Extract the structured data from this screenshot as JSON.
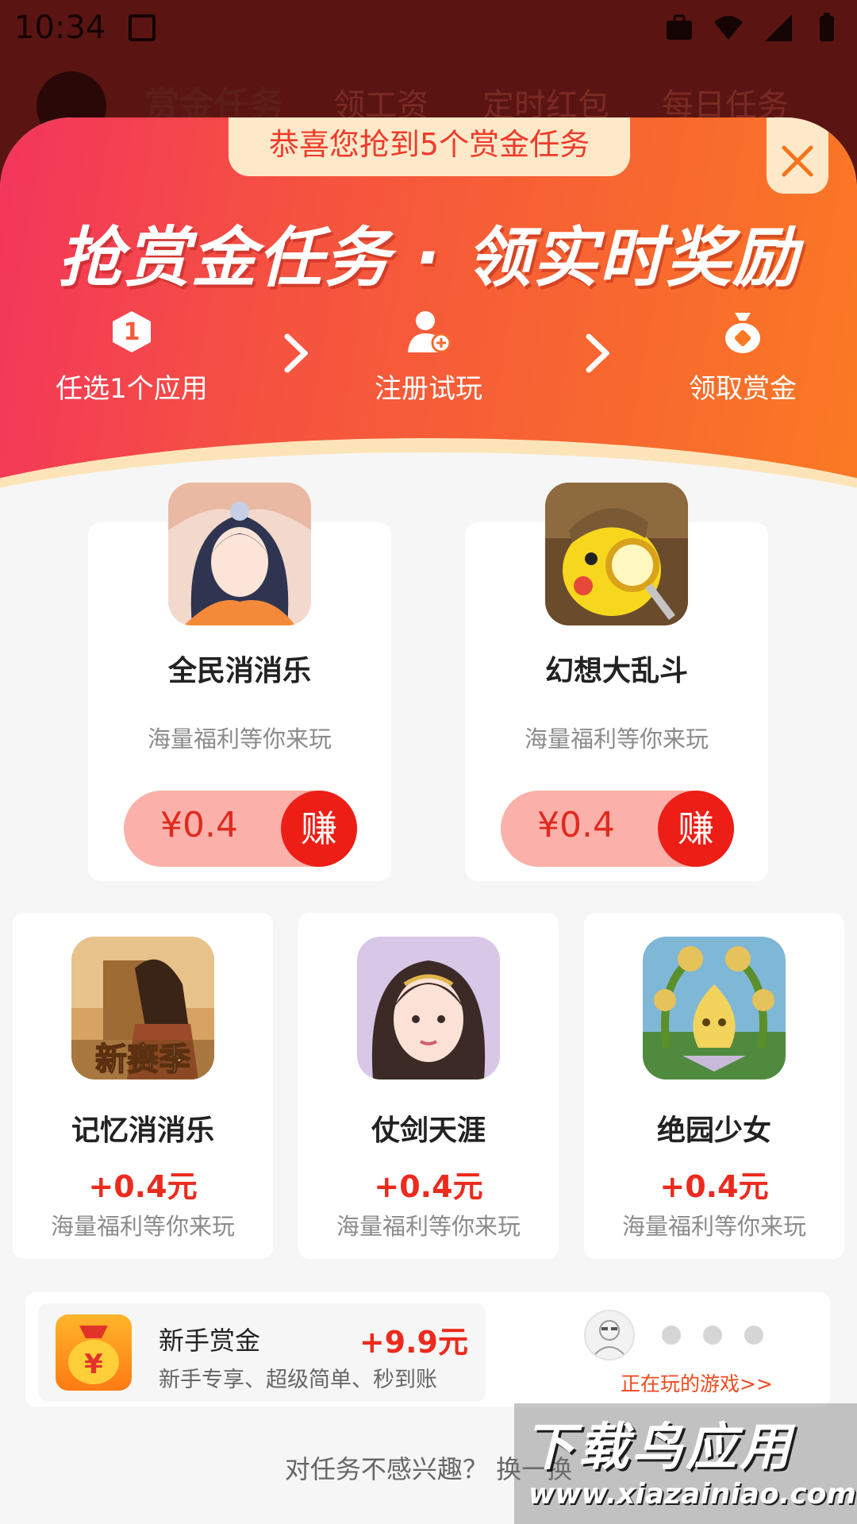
{
  "status_bar": {
    "time": "10:34"
  },
  "background_tabs": {
    "items": [
      "赏金任务",
      "领工资",
      "定时红包",
      "每日任务"
    ]
  },
  "modal": {
    "congrats": "恭喜您抢到5个赏金任务",
    "slogan": "抢赏金任务 · 领实时奖励",
    "steps": [
      {
        "label": "任选1个应用",
        "icon": "number-one-hex-icon",
        "badge": "1"
      },
      {
        "label": "注册试玩",
        "icon": "user-add-icon"
      },
      {
        "label": "领取赏金",
        "icon": "money-bag-icon"
      }
    ]
  },
  "big_tasks": [
    {
      "name": "全民消消乐",
      "desc": "海量福利等你来玩",
      "amount": "¥0.4",
      "action": "赚",
      "icon": "game-icon-heroine"
    },
    {
      "name": "幻想大乱斗",
      "desc": "海量福利等你来玩",
      "amount": "¥0.4",
      "action": "赚",
      "icon": "game-icon-pikachu-detective"
    }
  ],
  "small_tasks": [
    {
      "name": "记忆消消乐",
      "reward": "+0.4元",
      "desc": "海量福利等你来玩",
      "icon": "game-icon-warrior",
      "badge": "新赛季"
    },
    {
      "name": "仗剑天涯",
      "reward": "+0.4元",
      "desc": "海量福利等你来玩",
      "icon": "game-icon-fairy"
    },
    {
      "name": "绝园少女",
      "reward": "+0.4元",
      "desc": "海量福利等你来玩",
      "icon": "game-icon-plant"
    }
  ],
  "bottom": {
    "novice_title": "新手赏金",
    "novice_reward": "+9.9元",
    "novice_desc": "新手专享、超级简单、秒到账",
    "playing_link": "正在玩的游戏>>"
  },
  "change_text": "对任务不感兴趣？ 换一换",
  "watermark": {
    "title": "下载鸟应用",
    "url": "www.xiazainiao.com"
  },
  "colors": {
    "accent_red": "#ec1e16",
    "header_start": "#f3355d",
    "header_end": "#fb7a23",
    "cream": "#fde9c9"
  }
}
